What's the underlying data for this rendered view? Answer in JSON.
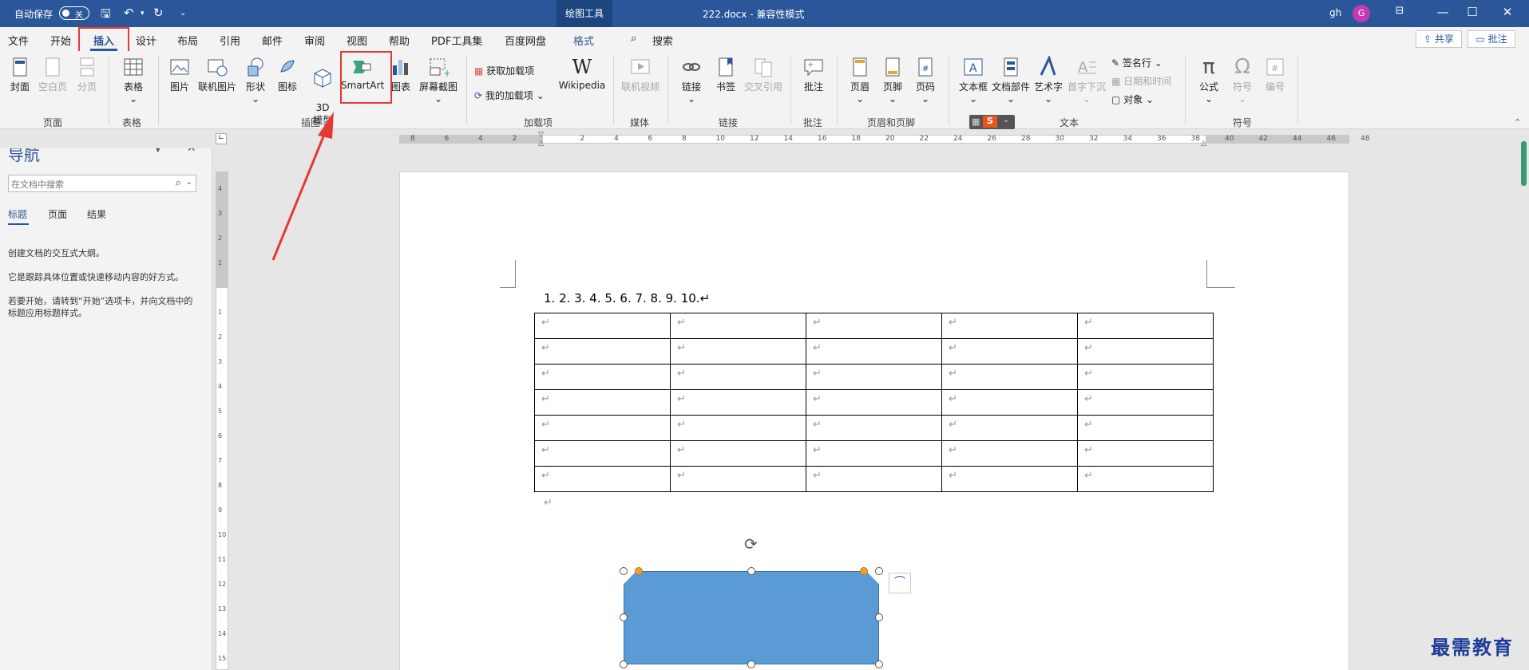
{
  "titlebar": {
    "autosave_label": "自动保存",
    "autosave_state": "关",
    "tool_tab": "绘图工具",
    "document_title": "222.docx  -  兼容性模式",
    "user_initials": "gh",
    "avatar_letter": "G"
  },
  "menu": {
    "items": [
      "文件",
      "开始",
      "插入",
      "设计",
      "布局",
      "引用",
      "邮件",
      "审阅",
      "视图",
      "帮助",
      "PDF工具集",
      "百度网盘"
    ],
    "format": "格式",
    "search": "搜索",
    "share": "共享",
    "comment": "批注",
    "active_index": 2
  },
  "ribbon": {
    "cover": "封面",
    "blank_page": "空白页",
    "page_break": "分页",
    "group_pages": "页面",
    "table": "表格",
    "group_table": "表格",
    "picture": "图片",
    "online_picture": "联机图片",
    "shapes": "形状",
    "icons": "图标",
    "model_3d": "3D\n模型",
    "smartart": "SmartArt",
    "chart": "图表",
    "screenshot": "屏幕截图",
    "group_illustrations": "插图",
    "get_addins": "获取加载项",
    "my_addins": "我的加载项",
    "wikipedia": "Wikipedia",
    "group_addins": "加载项",
    "online_video": "联机视频",
    "group_media": "媒体",
    "link": "链接",
    "bookmark": "书签",
    "cross_ref": "交叉引用",
    "group_links": "链接",
    "comment": "批注",
    "group_comments": "批注",
    "header": "页眉",
    "footer": "页脚",
    "page_number": "页码",
    "group_header_footer": "页眉和页脚",
    "textbox": "文本框",
    "quick_parts": "文档部件",
    "wordart": "艺术字",
    "drop_cap": "首字下沉",
    "signature_line": "签名行",
    "date_time": "日期和时间",
    "object": "对象",
    "group_text": "文本",
    "equation": "公式",
    "symbol": "符号",
    "number": "编号",
    "group_symbols": "符号"
  },
  "nav": {
    "title": "导航",
    "search_placeholder": "在文档中搜索",
    "tabs": [
      "标题",
      "页面",
      "结果"
    ],
    "messages": [
      "创建文档的交互式大纲。",
      "它是跟踪具体位置或快速移动内容的好方式。",
      "若要开始，请转到“开始”选项卡，并向文档中的标题应用标题样式。"
    ]
  },
  "ruler": {
    "h_ticks": [
      "8",
      "6",
      "4",
      "2",
      "",
      "2",
      "4",
      "6",
      "8",
      "10",
      "12",
      "14",
      "16",
      "18",
      "20",
      "22",
      "24",
      "26",
      "28",
      "30",
      "32",
      "34",
      "36",
      "38",
      "40",
      "42",
      "44",
      "46",
      "48"
    ],
    "v_ticks": [
      "4",
      "3",
      "2",
      "1",
      "",
      "1",
      "2",
      "3",
      "4",
      "5",
      "6",
      "7",
      "8",
      "9",
      "10",
      "11",
      "12",
      "13",
      "14",
      "15"
    ]
  },
  "document": {
    "list_text": "1. 2. 3. 4. 5. 6. 7. 8. 9. 10.↵",
    "paragraph_mark": "↵",
    "table_rows": 7,
    "table_cols": 5
  },
  "watermark": "最需教育",
  "colors": {
    "title_bar": "#2b579a",
    "shape_fill": "#5b9bd5",
    "highlight": "#e53935",
    "watermark": "#1f3c9a"
  }
}
